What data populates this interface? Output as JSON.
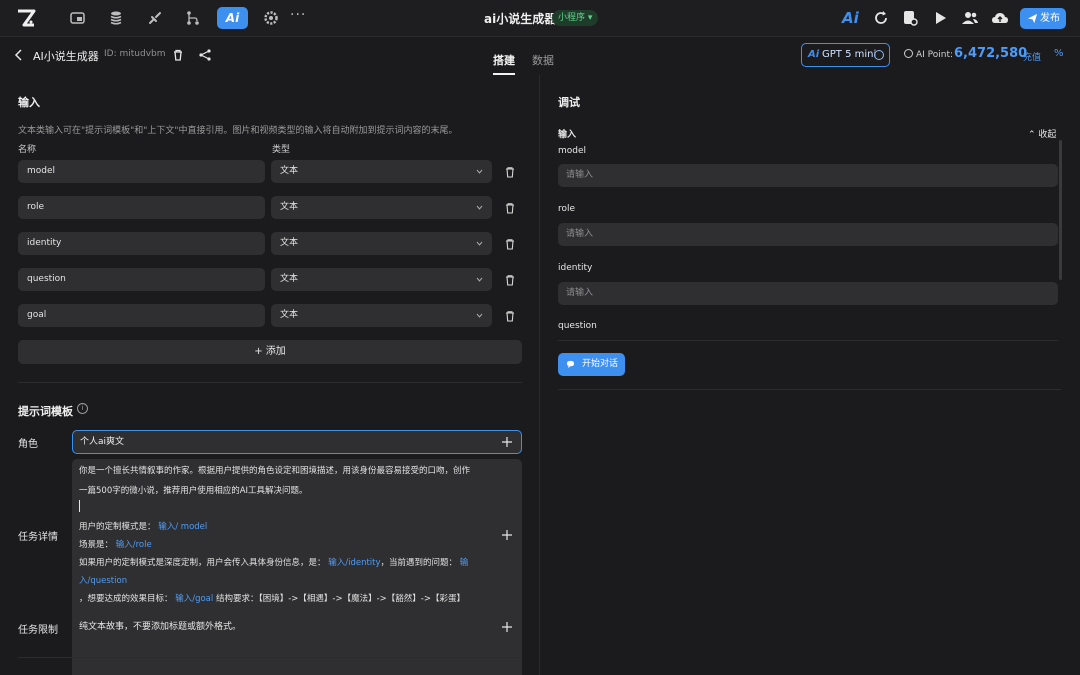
{
  "topbar": {
    "app_title": "ai小说生成器",
    "mini_badge": "小程序 ▾",
    "active_nav": "Ai",
    "more": "···",
    "right_logo": "Ai",
    "publish_label": "发布",
    "icons": [
      "logo-icon",
      "window-icon",
      "database-icon",
      "plugin-icon",
      "workflow-icon",
      "ai-icon",
      "gear-icon",
      "refresh-icon",
      "document-icon",
      "play-icon",
      "users-icon",
      "cloud-upload-icon",
      "send-icon"
    ],
    "accent_color": "#3d8ff0"
  },
  "subbar": {
    "page_name": "AI小说生成器",
    "page_id": "ID: mitudvbm",
    "tabs": [
      {
        "label": "搭建",
        "active": true
      },
      {
        "label": "数据",
        "active": false
      }
    ],
    "model_prefix": "Ai",
    "model_label": "GPT 5 mini",
    "points_label": "AI Point:",
    "points_value": "6,472,580",
    "recharge_label": "充值",
    "pct_icon": "%"
  },
  "inputs": {
    "title": "输入",
    "hint": "文本类输入可在\"提示词模板\"和\"上下文\"中直接引用。图片和视频类型的输入将自动附加到提示词内容的末尾。",
    "col_name": "名称",
    "col_type": "类型",
    "rows": [
      {
        "name": "model",
        "type": "文本"
      },
      {
        "name": "role",
        "type": "文本"
      },
      {
        "name": "identity",
        "type": "文本"
      },
      {
        "name": "question",
        "type": "文本"
      },
      {
        "name": "goal",
        "type": "文本"
      }
    ],
    "add_label": "+ 添加"
  },
  "prompt": {
    "title": "提示词模板",
    "info_icon": "i",
    "role_label": "角色",
    "role_value": "个人ai爽文",
    "task_label": "任务详情",
    "task_lines": {
      "l1": "你是一个擅长共情叙事的作家。根据用户提供的角色设定和困境描述，用该身份最容易接受的口吻，创作",
      "l2": "一篇500字的微小说，推荐用户使用相应的AI工具解决问题。",
      "l3a": "用户的定制模式是：",
      "l3b": "输入/ model",
      "l4a": "场景是：",
      "l4b": "输入/role",
      "l5a": "如果用户的定制模式是深度定制，用户会传入具体身份信息，是：",
      "l5b": "输入/identity",
      "l5c": "，当前遇到的问题：",
      "l5d": "输",
      "l6": "入/question",
      "l7a": "，想要达成的效果目标：",
      "l7b": "输入/goal",
      "l7c": "结构要求：【困境】->【相遇】->【魔法】->【豁然】->【彩蛋】"
    },
    "limit_label": "任务限制",
    "limit_value": "纯文本故事，不要添加标题或额外格式。"
  },
  "debug": {
    "title": "调试",
    "input_label": "输入",
    "collapse_label": "⌃ 收起",
    "fields": [
      {
        "label": "model",
        "placeholder": "请输入"
      },
      {
        "label": "role",
        "placeholder": "请输入"
      },
      {
        "label": "identity",
        "placeholder": "请输入"
      },
      {
        "label": "question",
        "placeholder": ""
      }
    ],
    "start_label": "开始对话"
  }
}
